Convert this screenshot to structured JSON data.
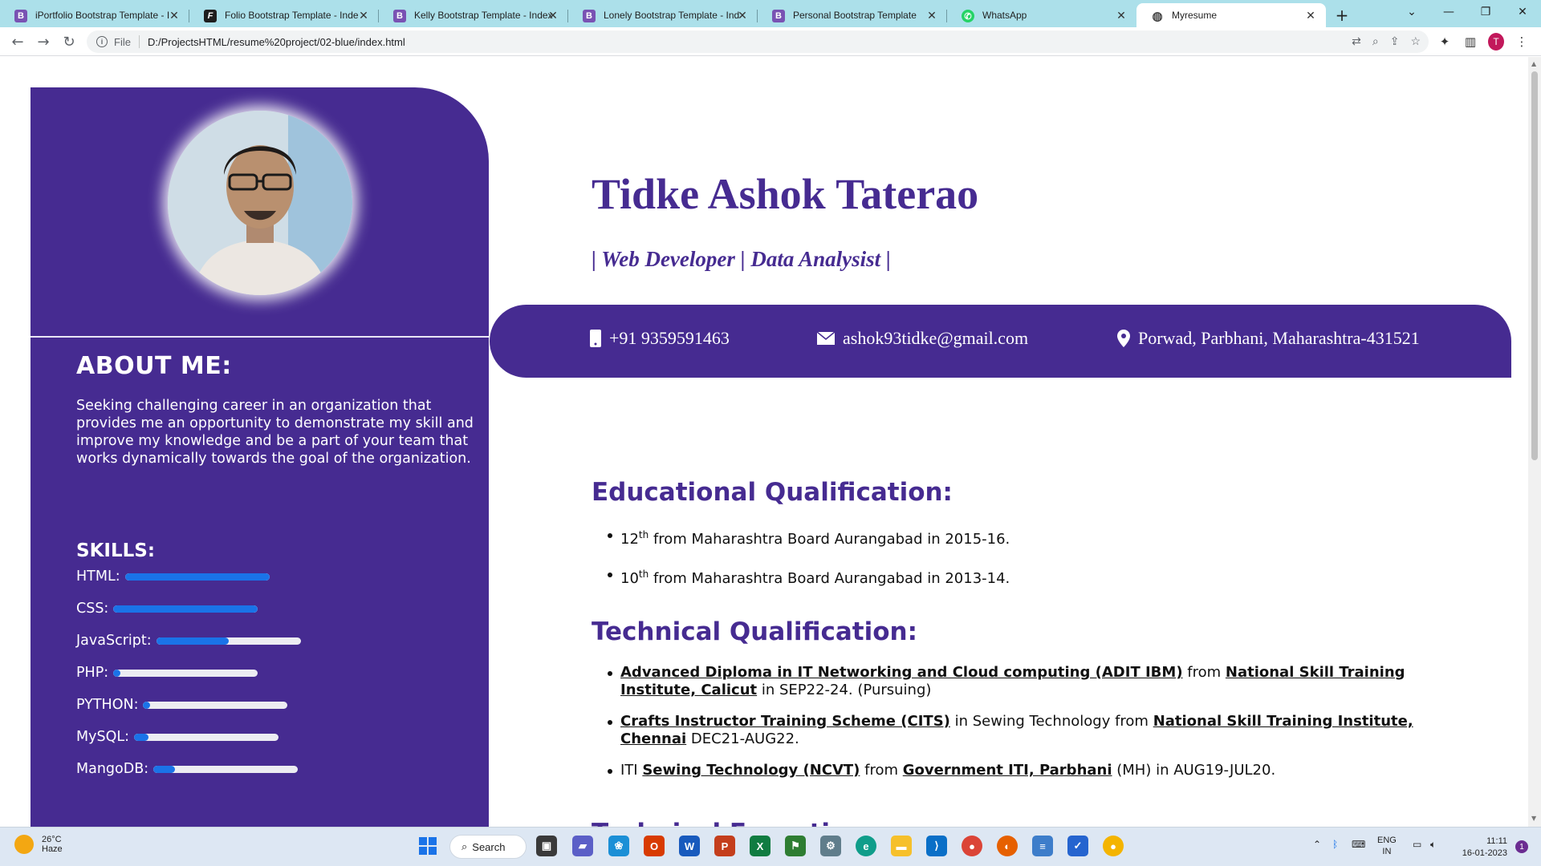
{
  "browser": {
    "tabs": [
      {
        "title": "iPortfolio Bootstrap Template - I",
        "icon": "bootstrap-icon",
        "glyph": "B"
      },
      {
        "title": "Folio Bootstrap Template - Inde",
        "icon": "folio-icon",
        "glyph": "F"
      },
      {
        "title": "Kelly Bootstrap Template - Index",
        "icon": "bootstrap-icon",
        "glyph": "B"
      },
      {
        "title": "Lonely Bootstrap Template - Ind",
        "icon": "bootstrap-icon",
        "glyph": "B"
      },
      {
        "title": "Personal Bootstrap Template",
        "icon": "bootstrap-icon",
        "glyph": "B"
      },
      {
        "title": "WhatsApp",
        "icon": "whatsapp-icon",
        "glyph": "✆"
      },
      {
        "title": "Myresume",
        "icon": "globe-icon",
        "glyph": "◍"
      }
    ],
    "active_tab": 6,
    "address_prefix": "File",
    "address": "D:/ProjectsHTML/resume%20project/02-blue/index.html",
    "profile_initial": "T"
  },
  "resume": {
    "name": "Tidke Ashok Taterao",
    "role": "| Web Developer | Data Analysist |",
    "contact": {
      "phone": "+91 9359591463",
      "email": "ashok93tidke@gmail.com",
      "address": "Porwad, Parbhani, Maharashtra-431521"
    },
    "about_heading": "ABOUT ME:",
    "about_text": "Seeking challenging career in an organization that provides me an opportunity to demonstrate my skill and improve my knowledge and be a part of your team that works dynamically towards the goal of the organization.",
    "skills_heading": "SKILLS:",
    "skills": [
      {
        "label": "HTML:",
        "level": 1.0
      },
      {
        "label": "CSS:",
        "level": 1.0
      },
      {
        "label": "JavaScript:",
        "level": 0.5
      },
      {
        "label": "PHP:",
        "level": 0.05
      },
      {
        "label": "PYTHON:",
        "level": 0.05
      },
      {
        "label": "MySQL:",
        "level": 0.1
      },
      {
        "label": "MangoDB:",
        "level": 0.15
      }
    ],
    "education_heading": "Educational Qualification:",
    "education": [
      {
        "grade": "12",
        "sup": "th",
        "text": " from Maharashtra Board Aurangabad in 2015-16."
      },
      {
        "grade": "10",
        "sup": "th",
        "text": " from Maharashtra Board Aurangabad in 2013-14."
      }
    ],
    "technical_heading": "Technical Qualification:",
    "technical": [
      {
        "pre": "",
        "course": "Advanced Diploma in IT Networking and Cloud computing (ADIT IBM)",
        "mid": " from ",
        "institute": "National Skill Training Institute, Calicut",
        "post": " in SEP22-24. (Pursuing)"
      },
      {
        "pre": "",
        "course": "Crafts Instructor Training Scheme (CITS)",
        "mid": " in Sewing Technology from ",
        "institute": "National Skill Training Institute, Chennai",
        "post": " DEC21-AUG22."
      },
      {
        "pre": "ITI ",
        "course": "Sewing Technology (NCVT)",
        "mid": " from ",
        "institute": "Government ITI, Parbhani",
        "post": " (MH) in AUG19-JUL20."
      }
    ],
    "next_heading_partial": "Technical Expertise:"
  },
  "taskbar": {
    "weather_temp": "26°C",
    "weather_desc": "Haze",
    "search_label": "Search",
    "lang_top": "ENG",
    "lang_bottom": "IN",
    "time": "11:11",
    "date": "16-01-2023",
    "notifications": "1"
  },
  "colors": {
    "brand_purple": "#462b91",
    "skill_blue": "#1a73e8",
    "tab_strip": "#ace0ea"
  }
}
